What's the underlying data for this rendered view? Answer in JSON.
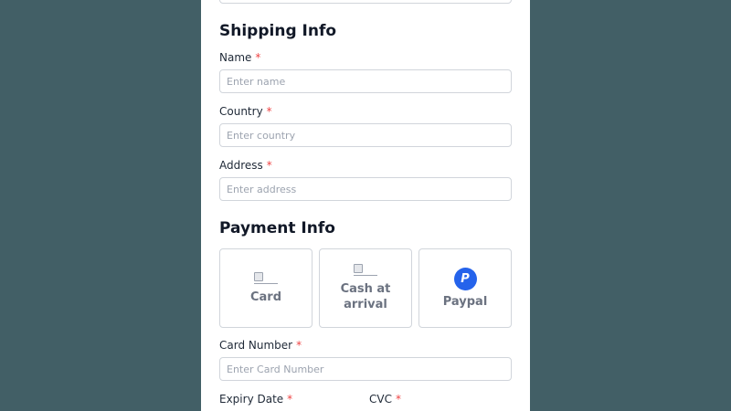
{
  "shipping": {
    "title": "Shipping Info",
    "name": {
      "label": "Name",
      "required": "*",
      "placeholder": "Enter name",
      "value": ""
    },
    "country": {
      "label": "Country",
      "required": "*",
      "placeholder": "Enter country",
      "value": ""
    },
    "address": {
      "label": "Address",
      "required": "*",
      "placeholder": "Enter address",
      "value": ""
    }
  },
  "payment": {
    "title": "Payment Info",
    "options": [
      {
        "label": "Card",
        "icon": "card-icon-broken-image"
      },
      {
        "label": "Cash at arrival",
        "icon": "cash-icon-broken-image"
      },
      {
        "label": "Paypal",
        "icon": "paypal-icon",
        "icon_glyph": "P"
      }
    ],
    "card_number": {
      "label": "Card Number",
      "required": "*",
      "placeholder": "Enter Card Number",
      "value": ""
    },
    "expiry_date": {
      "label": "Expiry Date",
      "required": "*"
    },
    "cvc": {
      "label": "CVC",
      "required": "*"
    }
  },
  "colors": {
    "page_background": "#425f66",
    "panel_background": "#ffffff",
    "required_marker": "#ef4444",
    "paypal_brand": "#2563eb"
  }
}
